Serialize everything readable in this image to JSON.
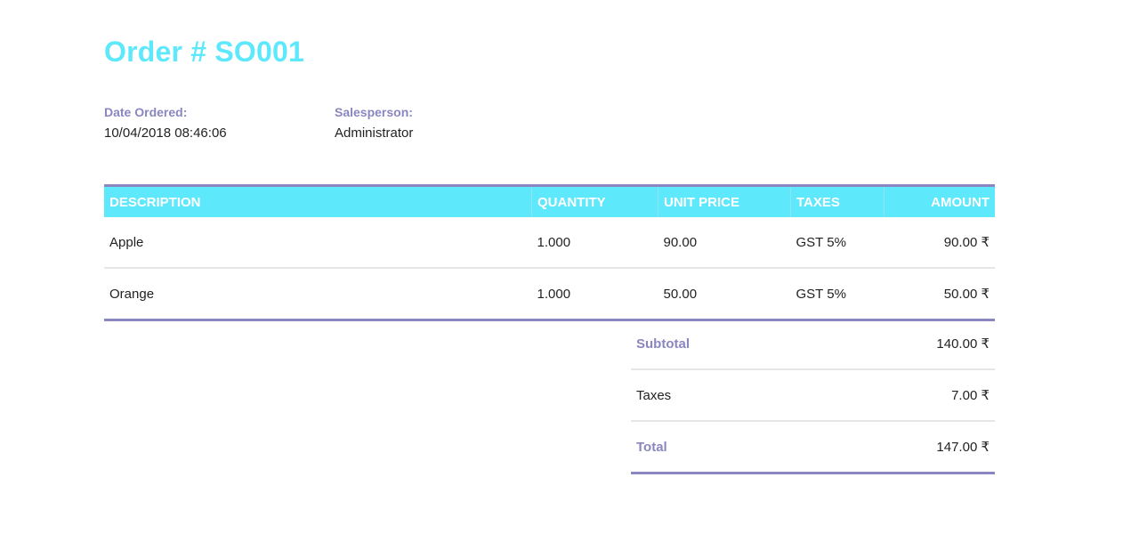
{
  "order": {
    "title": "Order # SO001",
    "date_label": "Date Ordered:",
    "date_value": "10/04/2018 08:46:06",
    "salesperson_label": "Salesperson:",
    "salesperson_value": "Administrator"
  },
  "table": {
    "headers": {
      "description": "DESCRIPTION",
      "quantity": "QUANTITY",
      "unit_price": "UNIT PRICE",
      "taxes": "TAXES",
      "amount": "AMOUNT"
    },
    "rows": [
      {
        "description": "Apple",
        "quantity": "1.000",
        "unit_price": "90.00",
        "taxes": "GST 5%",
        "amount": "90.00 ₹"
      },
      {
        "description": "Orange",
        "quantity": "1.000",
        "unit_price": "50.00",
        "taxes": "GST 5%",
        "amount": "50.00 ₹"
      }
    ]
  },
  "totals": {
    "subtotal_label": "Subtotal",
    "subtotal_value": "140.00 ₹",
    "taxes_label": "Taxes",
    "taxes_value": "7.00 ₹",
    "total_label": "Total",
    "total_value": "147.00 ₹"
  },
  "colors": {
    "accent_cyan": "#5ee8fb",
    "accent_purple": "#8a86c0"
  }
}
